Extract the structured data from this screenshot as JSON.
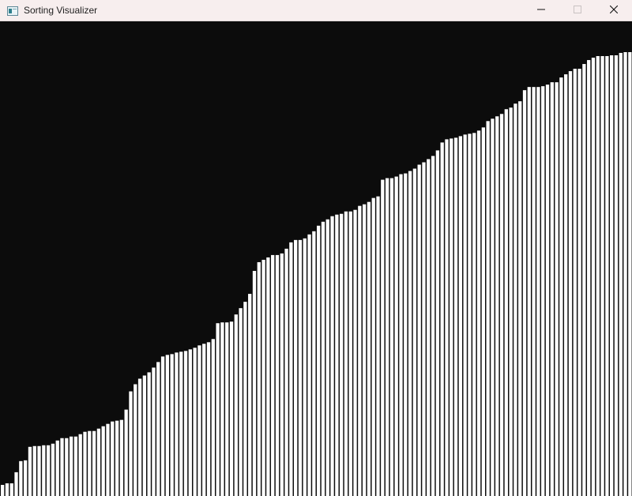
{
  "window": {
    "title": "Sorting Visualizer",
    "app_icon": "app-window-icon",
    "controls": [
      "minimize-icon",
      "maximize-icon",
      "close-icon"
    ]
  },
  "colors": {
    "titlebar_bg": "#f7eeee",
    "canvas_bg": "#0c0c0c",
    "bar_fill": "#ffffff"
  },
  "visualizer": {
    "state": "sorted ascending",
    "max_value": 560,
    "values": [
      14,
      16,
      16,
      30,
      44,
      45,
      62,
      63,
      63,
      64,
      64,
      66,
      70,
      73,
      73,
      75,
      75,
      78,
      81,
      82,
      82,
      85,
      88,
      91,
      94,
      95,
      96,
      109,
      132,
      141,
      148,
      152,
      156,
      162,
      169,
      176,
      178,
      179,
      181,
      182,
      183,
      185,
      187,
      190,
      192,
      194,
      198,
      218,
      219,
      219,
      220,
      229,
      237,
      245,
      255,
      284,
      295,
      298,
      301,
      304,
      304,
      306,
      312,
      320,
      323,
      323,
      325,
      330,
      334,
      341,
      346,
      349,
      353,
      355,
      356,
      359,
      359,
      361,
      366,
      368,
      371,
      376,
      378,
      399,
      401,
      401,
      403,
      406,
      407,
      410,
      413,
      418,
      421,
      425,
      429,
      436,
      446,
      450,
      451,
      452,
      454,
      456,
      457,
      458,
      461,
      465,
      473,
      476,
      479,
      482,
      488,
      490,
      495,
      498,
      512,
      516,
      516,
      516,
      517,
      519,
      522,
      522,
      528,
      532,
      536,
      539,
      539,
      545,
      550,
      553,
      555,
      555,
      555,
      556,
      556,
      559,
      560,
      560
    ]
  }
}
